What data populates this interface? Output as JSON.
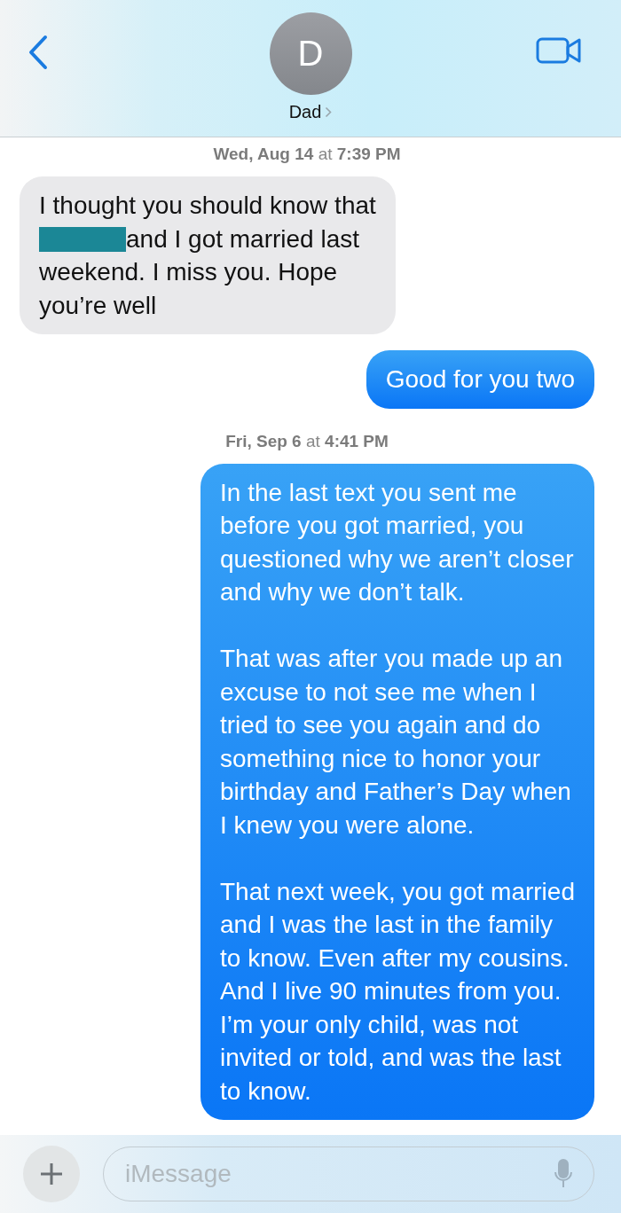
{
  "header": {
    "avatar_initial": "D",
    "contact_name": "Dad"
  },
  "messages": [
    {
      "kind": "timestamp",
      "text": "**Wed, Aug 14** at **7:39 PM**"
    },
    {
      "kind": "incoming",
      "parts": [
        {
          "kind": "text",
          "text": "I thought you should know that\n"
        },
        {
          "kind": "redaction"
        },
        {
          "kind": "text",
          "text": "and I got married last\nweekend. I miss you. Hope\nyou’re well"
        }
      ]
    },
    {
      "kind": "outgoing",
      "paragraphs": [
        "Good for you two"
      ]
    },
    {
      "kind": "timestamp",
      "text": "**Fri, Sep 6** at **4:41 PM**"
    },
    {
      "kind": "outgoing",
      "paragraphs": [
        "In the last text you sent me\nbefore you got married, you\nquestioned why we aren’t closer\nand why we don’t talk.",
        "That was after you made up an\nexcuse to not see me when I\ntried to see you again and do\nsomething nice to honor your\nbirthday and Father’s Day when\nI knew you were alone.",
        "That next week, you got married\nand I was the last in the family\nto know. Even after my cousins.\nAnd I live 90 minutes from you.\nI’m your only child, was not\ninvited or told, and was the last\nto know."
      ]
    }
  ],
  "composer": {
    "placeholder": "iMessage"
  }
}
